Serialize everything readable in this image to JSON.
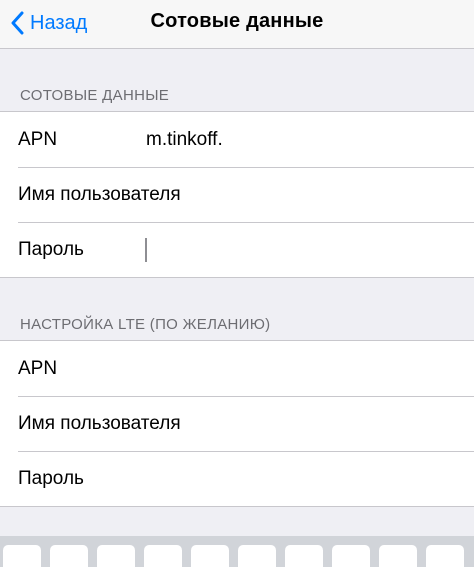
{
  "navbar": {
    "back_label": "Назад",
    "title": "Сотовые данные"
  },
  "section1": {
    "header": "СОТОВЫЕ ДАННЫЕ",
    "rows": [
      {
        "label": "APN",
        "value": "m.tinkoff."
      },
      {
        "label": "Имя пользователя",
        "value": ""
      },
      {
        "label": "Пароль",
        "value": ""
      }
    ]
  },
  "section2": {
    "header": "НАСТРОЙКА LTE (ПО ЖЕЛАНИЮ)",
    "rows": [
      {
        "label": "APN",
        "value": ""
      },
      {
        "label": "Имя пользователя",
        "value": ""
      },
      {
        "label": "Пароль",
        "value": ""
      }
    ]
  },
  "colors": {
    "accent": "#007aff",
    "background": "#efeff4",
    "separator": "#c8c7cc"
  }
}
